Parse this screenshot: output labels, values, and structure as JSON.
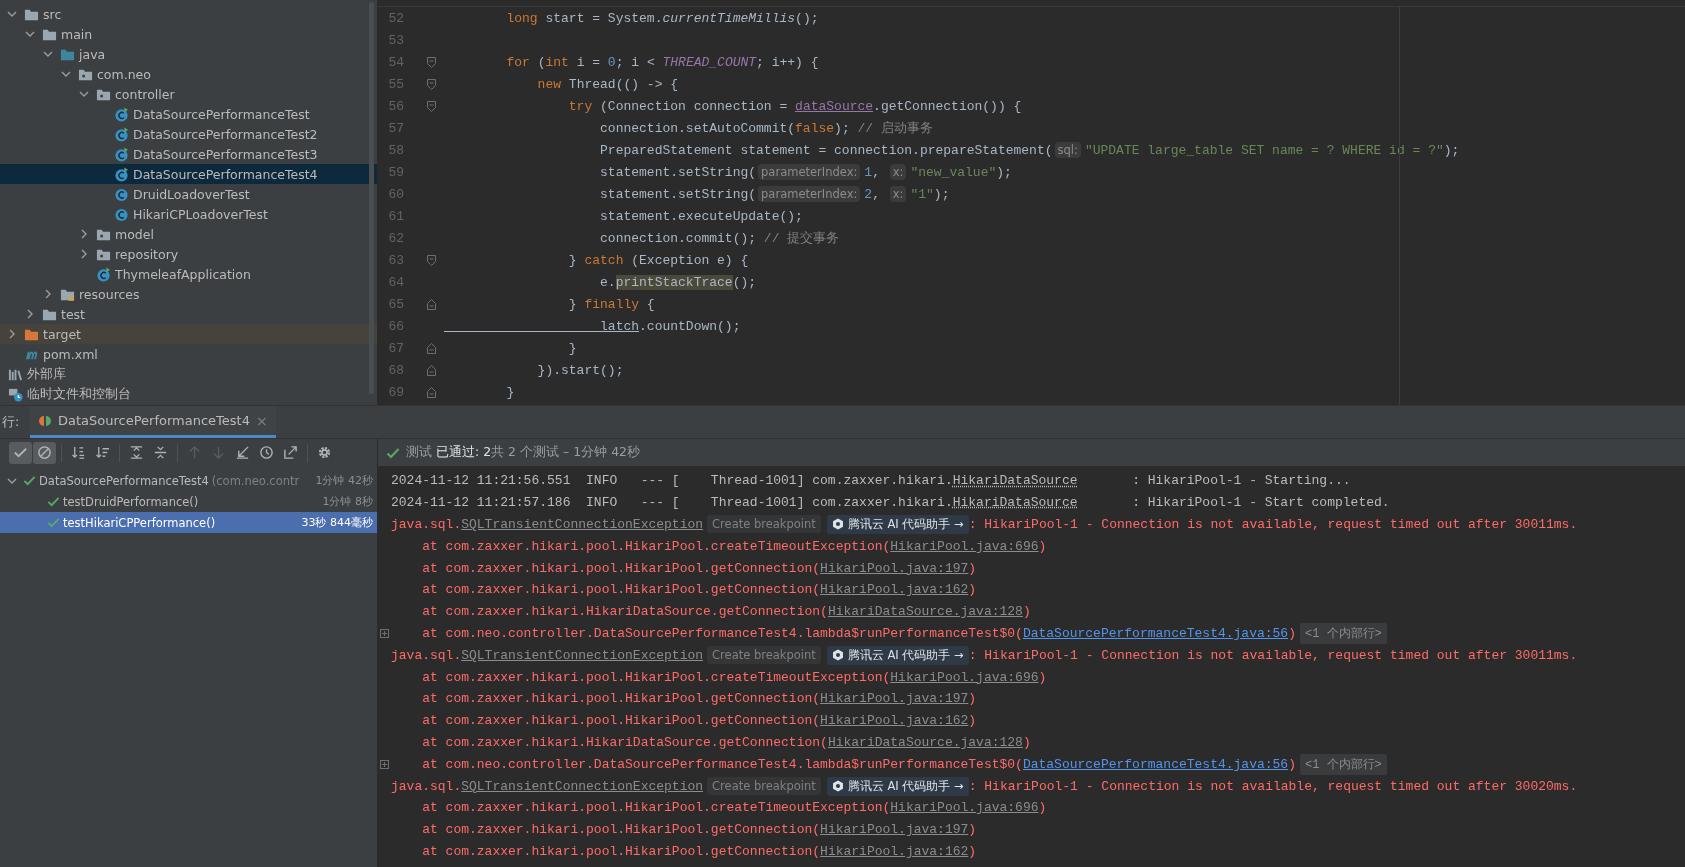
{
  "project_tree": {
    "items": [
      {
        "label": "src",
        "kind": "folder",
        "expanded": true,
        "selected": false,
        "children": [
          {
            "label": "main",
            "kind": "folder",
            "expanded": true,
            "selected": false,
            "children": [
              {
                "label": "java",
                "kind": "source-folder",
                "expanded": true,
                "selected": false,
                "children": [
                  {
                    "label": "com.neo",
                    "kind": "package",
                    "expanded": true,
                    "selected": false,
                    "children": [
                      {
                        "label": "controller",
                        "kind": "package",
                        "expanded": true,
                        "selected": false,
                        "children": [
                          {
                            "label": "DataSourcePerformanceTest",
                            "kind": "runnable-class",
                            "selected": false
                          },
                          {
                            "label": "DataSourcePerformanceTest2",
                            "kind": "runnable-class",
                            "selected": false
                          },
                          {
                            "label": "DataSourcePerformanceTest3",
                            "kind": "runnable-class",
                            "selected": false
                          },
                          {
                            "label": "DataSourcePerformanceTest4",
                            "kind": "runnable-class",
                            "selected": true
                          },
                          {
                            "label": "DruidLoadoverTest",
                            "kind": "class",
                            "selected": false
                          },
                          {
                            "label": "HikariCPLoadoverTest",
                            "kind": "class",
                            "selected": false
                          }
                        ]
                      },
                      {
                        "label": "model",
                        "kind": "package",
                        "expanded": false,
                        "selected": false
                      },
                      {
                        "label": "repository",
                        "kind": "package",
                        "expanded": false,
                        "selected": false
                      },
                      {
                        "label": "ThymeleafApplication",
                        "kind": "runnable-class",
                        "selected": false
                      }
                    ]
                  }
                ]
              },
              {
                "label": "resources",
                "kind": "resources",
                "expanded": false,
                "selected": false
              }
            ]
          },
          {
            "label": "test",
            "kind": "folder",
            "expanded": false,
            "selected": false
          }
        ]
      },
      {
        "label": "target",
        "kind": "excluded-folder",
        "expanded": false,
        "selected": false
      },
      {
        "label": "pom.xml",
        "kind": "maven",
        "selected": false
      },
      {
        "label": "外部库",
        "kind": "library",
        "selected": false
      },
      {
        "label": "临时文件和控制台",
        "kind": "scratch",
        "selected": false
      }
    ]
  },
  "editor": {
    "lines": [
      {
        "number": "52",
        "kind": "plain",
        "tokens": [
          {
            "kind": "kw",
            "text": "        long"
          },
          {
            "kind": "plain",
            "text": " start = System."
          },
          {
            "kind": "static",
            "text": "currentTimeMillis"
          },
          {
            "kind": "plain",
            "text": "();"
          }
        ]
      },
      {
        "number": "53",
        "kind": "plain"
      },
      {
        "number": "54",
        "kind": "fold-start",
        "tokens": [
          {
            "kind": "kw",
            "text": "        for"
          },
          {
            "kind": "plain",
            "text": " ("
          },
          {
            "kind": "kw",
            "text": "int"
          },
          {
            "kind": "plain",
            "text": " i = "
          },
          {
            "kind": "num",
            "text": "0"
          },
          {
            "kind": "plain",
            "text": "; i < "
          },
          {
            "kind": "const",
            "text": "THREAD_COUNT"
          },
          {
            "kind": "plain",
            "text": "; i++) {"
          }
        ]
      },
      {
        "number": "55",
        "kind": "fold-start",
        "tokens": [
          {
            "kind": "kw",
            "text": "            new"
          },
          {
            "kind": "plain",
            "text": " Thread(() -> {"
          }
        ]
      },
      {
        "number": "56",
        "kind": "fold-start",
        "tokens": [
          {
            "kind": "kw",
            "text": "                try"
          },
          {
            "kind": "plain",
            "text": " (Connection connection = "
          },
          {
            "kind": "field",
            "text": "dataSource"
          },
          {
            "kind": "plain",
            "text": ".getConnection()) {"
          }
        ]
      },
      {
        "number": "57",
        "kind": "plain",
        "tokens": [
          {
            "kind": "plain",
            "text": "                    connection.setAutoCommit("
          },
          {
            "kind": "kw",
            "text": "false"
          },
          {
            "kind": "plain",
            "text": "); "
          },
          {
            "kind": "comment",
            "text": "// 启动事务"
          }
        ]
      },
      {
        "number": "58",
        "kind": "plain",
        "tokens": [
          {
            "kind": "plain",
            "text": "                    PreparedStatement statement = connection.prepareStatement("
          },
          {
            "kind": "hint",
            "text": "sql:"
          },
          {
            "kind": "str",
            "text": "\"UPDATE large_table SET name = ? WHERE id = ?\""
          },
          {
            "kind": "plain",
            "text": ");"
          }
        ]
      },
      {
        "number": "59",
        "kind": "plain",
        "tokens": [
          {
            "kind": "plain",
            "text": "                    statement.setString("
          },
          {
            "kind": "hint",
            "text": "parameterIndex:"
          },
          {
            "kind": "num",
            "text": "1"
          },
          {
            "kind": "plain",
            "text": ", "
          },
          {
            "kind": "hint",
            "text": "x:"
          },
          {
            "kind": "str",
            "text": "\"new_value\""
          },
          {
            "kind": "plain",
            "text": ");"
          }
        ]
      },
      {
        "number": "60",
        "kind": "plain",
        "tokens": [
          {
            "kind": "plain",
            "text": "                    statement.setString("
          },
          {
            "kind": "hint",
            "text": "parameterIndex:"
          },
          {
            "kind": "num",
            "text": "2"
          },
          {
            "kind": "plain",
            "text": ", "
          },
          {
            "kind": "hint",
            "text": "x:"
          },
          {
            "kind": "str",
            "text": "\"1\""
          },
          {
            "kind": "plain",
            "text": ");"
          }
        ]
      },
      {
        "number": "61",
        "kind": "plain",
        "tokens": [
          {
            "kind": "plain",
            "text": "                    statement.executeUpdate();"
          }
        ]
      },
      {
        "number": "62",
        "kind": "plain",
        "tokens": [
          {
            "kind": "plain",
            "text": "                    connection.commit(); "
          },
          {
            "kind": "comment",
            "text": "// 提交事务"
          }
        ]
      },
      {
        "number": "63",
        "kind": "fold-start",
        "tokens": [
          {
            "kind": "plain",
            "text": "                } "
          },
          {
            "kind": "kw",
            "text": "catch"
          },
          {
            "kind": "plain",
            "text": " (Exception e) {"
          }
        ]
      },
      {
        "number": "64",
        "kind": "plain",
        "tokens": [
          {
            "kind": "plain",
            "text": "                    e."
          },
          {
            "kind": "highlight",
            "text": "printStackTrace"
          },
          {
            "kind": "plain",
            "text": "();"
          }
        ]
      },
      {
        "number": "65",
        "kind": "fold-end",
        "tokens": [
          {
            "kind": "plain",
            "text": "                } "
          },
          {
            "kind": "kw",
            "text": "finally"
          },
          {
            "kind": "plain",
            "text": " {"
          }
        ]
      },
      {
        "number": "66",
        "kind": "plain",
        "tokens": [
          {
            "kind": "underlined",
            "text": "                    latch"
          },
          {
            "kind": "plain",
            "text": ".countDown();"
          }
        ]
      },
      {
        "number": "67",
        "kind": "fold-end",
        "tokens": [
          {
            "kind": "plain",
            "text": "                }"
          }
        ]
      },
      {
        "number": "68",
        "kind": "fold-end",
        "tokens": [
          {
            "kind": "plain",
            "text": "            }).start();"
          }
        ]
      },
      {
        "number": "69",
        "kind": "fold-end",
        "tokens": [
          {
            "kind": "plain",
            "text": "        }"
          }
        ]
      }
    ]
  },
  "run_panel": {
    "label": "行:",
    "tab": {
      "label": "DataSourcePerformanceTest4",
      "close": "×",
      "selected": true
    },
    "toolbar": [
      {
        "kind": "show-passed",
        "on": true,
        "disabled": false
      },
      {
        "kind": "show-ignored",
        "on": true,
        "disabled": false
      },
      {
        "kind": "sort-alpha",
        "on": false,
        "disabled": false
      },
      {
        "kind": "sort-duration",
        "on": false,
        "disabled": false
      },
      {
        "kind": "expand-all",
        "on": false,
        "disabled": false
      },
      {
        "kind": "collapse-all",
        "on": false,
        "disabled": false
      },
      {
        "kind": "previous",
        "on": false,
        "disabled": true
      },
      {
        "kind": "next",
        "on": false,
        "disabled": true
      },
      {
        "kind": "import",
        "on": false,
        "disabled": false
      },
      {
        "kind": "history",
        "on": false,
        "disabled": false
      },
      {
        "kind": "export",
        "on": false,
        "disabled": false
      },
      {
        "kind": "settings",
        "on": false,
        "disabled": false
      }
    ],
    "status": "测试 **已通过: 2**共 2 个测试 – 1分钟 42秒",
    "tests": [
      {
        "name": "DataSourcePerformanceTest4",
        "detail": "(com.neo.contr",
        "time": "1分钟 42秒",
        "passed": true,
        "expanded": true,
        "selected": false,
        "children": [
          {
            "name": "testDruidPerformance()",
            "time": "1分钟 8秒",
            "passed": true,
            "selected": false
          },
          {
            "name": "testHikariCPPerformance()",
            "time": "33秒 844毫秒",
            "passed": true,
            "selected": true
          }
        ]
      }
    ]
  },
  "console": {
    "lines": [
      {
        "collapsible": false,
        "segments": [
          {
            "kind": "text",
            "text": "2024-11-12 11:21:56.551  INFO   --- [    Thread-1001] com.zaxxer.hikari."
          },
          {
            "kind": "dotted",
            "text": "HikariDataSource"
          },
          {
            "kind": "text",
            "text": "       : HikariPool-1 - Starting..."
          }
        ]
      },
      {
        "collapsible": false,
        "segments": [
          {
            "kind": "text",
            "text": "2024-11-12 11:21:57.186  INFO   --- [    Thread-1001] com.zaxxer.hikari."
          },
          {
            "kind": "dotted",
            "text": "HikariDataSource"
          },
          {
            "kind": "text",
            "text": "       : HikariPool-1 - Start completed."
          }
        ]
      },
      {
        "collapsible": false,
        "segments": [
          {
            "kind": "error",
            "text": "java.sql."
          },
          {
            "kind": "error-link",
            "text": "SQLTransientConnectionException"
          },
          {
            "kind": "breakpoint",
            "text": "Create breakpoint"
          },
          {
            "kind": "ai",
            "text": "腾讯云 AI 代码助手 →"
          },
          {
            "kind": "error",
            "text": ": HikariPool-1 - Connection is not available, request timed out after 30011ms."
          }
        ]
      },
      {
        "collapsible": false,
        "segments": [
          {
            "kind": "error",
            "text": "    at com.zaxxer.hikari.pool.HikariPool.createTimeoutException("
          },
          {
            "kind": "link",
            "text": "HikariPool.java:696"
          },
          {
            "kind": "error",
            "text": ")"
          }
        ]
      },
      {
        "collapsible": false,
        "segments": [
          {
            "kind": "error",
            "text": "    at com.zaxxer.hikari.pool.HikariPool.getConnection("
          },
          {
            "kind": "link",
            "text": "HikariPool.java:197"
          },
          {
            "kind": "error",
            "text": ")"
          }
        ]
      },
      {
        "collapsible": false,
        "segments": [
          {
            "kind": "error",
            "text": "    at com.zaxxer.hikari.pool.HikariPool.getConnection("
          },
          {
            "kind": "link",
            "text": "HikariPool.java:162"
          },
          {
            "kind": "error",
            "text": ")"
          }
        ]
      },
      {
        "collapsible": false,
        "segments": [
          {
            "kind": "error",
            "text": "    at com.zaxxer.hikari.HikariDataSource.getConnection("
          },
          {
            "kind": "link",
            "text": "HikariDataSource.java:128"
          },
          {
            "kind": "error",
            "text": ")"
          }
        ]
      },
      {
        "collapsible": true,
        "segments": [
          {
            "kind": "error",
            "text": "    at com.neo.controller.DataSourcePerformanceTest4.lambda$runPerformanceTest$0("
          },
          {
            "kind": "blue-link",
            "text": "DataSourcePerformanceTest4.java:56"
          },
          {
            "kind": "error",
            "text": ")"
          },
          {
            "kind": "folded",
            "text": "<1 个内部行>"
          }
        ]
      },
      {
        "collapsible": false,
        "segments": [
          {
            "kind": "error",
            "text": "java.sql."
          },
          {
            "kind": "error-link",
            "text": "SQLTransientConnectionException"
          },
          {
            "kind": "breakpoint",
            "text": "Create breakpoint"
          },
          {
            "kind": "ai",
            "text": "腾讯云 AI 代码助手 →"
          },
          {
            "kind": "error",
            "text": ": HikariPool-1 - Connection is not available, request timed out after 30011ms."
          }
        ]
      },
      {
        "collapsible": false,
        "segments": [
          {
            "kind": "error",
            "text": "    at com.zaxxer.hikari.pool.HikariPool.createTimeoutException("
          },
          {
            "kind": "link",
            "text": "HikariPool.java:696"
          },
          {
            "kind": "error",
            "text": ")"
          }
        ]
      },
      {
        "collapsible": false,
        "segments": [
          {
            "kind": "error",
            "text": "    at com.zaxxer.hikari.pool.HikariPool.getConnection("
          },
          {
            "kind": "link",
            "text": "HikariPool.java:197"
          },
          {
            "kind": "error",
            "text": ")"
          }
        ]
      },
      {
        "collapsible": false,
        "segments": [
          {
            "kind": "error",
            "text": "    at com.zaxxer.hikari.pool.HikariPool.getConnection("
          },
          {
            "kind": "link",
            "text": "HikariPool.java:162"
          },
          {
            "kind": "error",
            "text": ")"
          }
        ]
      },
      {
        "collapsible": false,
        "segments": [
          {
            "kind": "error",
            "text": "    at com.zaxxer.hikari.HikariDataSource.getConnection("
          },
          {
            "kind": "link",
            "text": "HikariDataSource.java:128"
          },
          {
            "kind": "error",
            "text": ")"
          }
        ]
      },
      {
        "collapsible": true,
        "segments": [
          {
            "kind": "error",
            "text": "    at com.neo.controller.DataSourcePerformanceTest4.lambda$runPerformanceTest$0("
          },
          {
            "kind": "blue-link",
            "text": "DataSourcePerformanceTest4.java:56"
          },
          {
            "kind": "error",
            "text": ")"
          },
          {
            "kind": "folded",
            "text": "<1 个内部行>"
          }
        ]
      },
      {
        "collapsible": false,
        "segments": [
          {
            "kind": "error",
            "text": "java.sql."
          },
          {
            "kind": "error-link",
            "text": "SQLTransientConnectionException"
          },
          {
            "kind": "breakpoint",
            "text": "Create breakpoint"
          },
          {
            "kind": "ai",
            "text": "腾讯云 AI 代码助手 →"
          },
          {
            "kind": "error",
            "text": ": HikariPool-1 - Connection is not available, request timed out after 30020ms."
          }
        ]
      },
      {
        "collapsible": false,
        "segments": [
          {
            "kind": "error",
            "text": "    at com.zaxxer.hikari.pool.HikariPool.createTimeoutException("
          },
          {
            "kind": "link",
            "text": "HikariPool.java:696"
          },
          {
            "kind": "error",
            "text": ")"
          }
        ]
      },
      {
        "collapsible": false,
        "segments": [
          {
            "kind": "error",
            "text": "    at com.zaxxer.hikari.pool.HikariPool.getConnection("
          },
          {
            "kind": "link",
            "text": "HikariPool.java:197"
          },
          {
            "kind": "error",
            "text": ")"
          }
        ]
      },
      {
        "collapsible": false,
        "segments": [
          {
            "kind": "error",
            "text": "    at com.zaxxer.hikari.pool.HikariPool.getConnection("
          },
          {
            "kind": "link",
            "text": "HikariPool.java:162"
          },
          {
            "kind": "error",
            "text": ")"
          }
        ]
      }
    ]
  }
}
